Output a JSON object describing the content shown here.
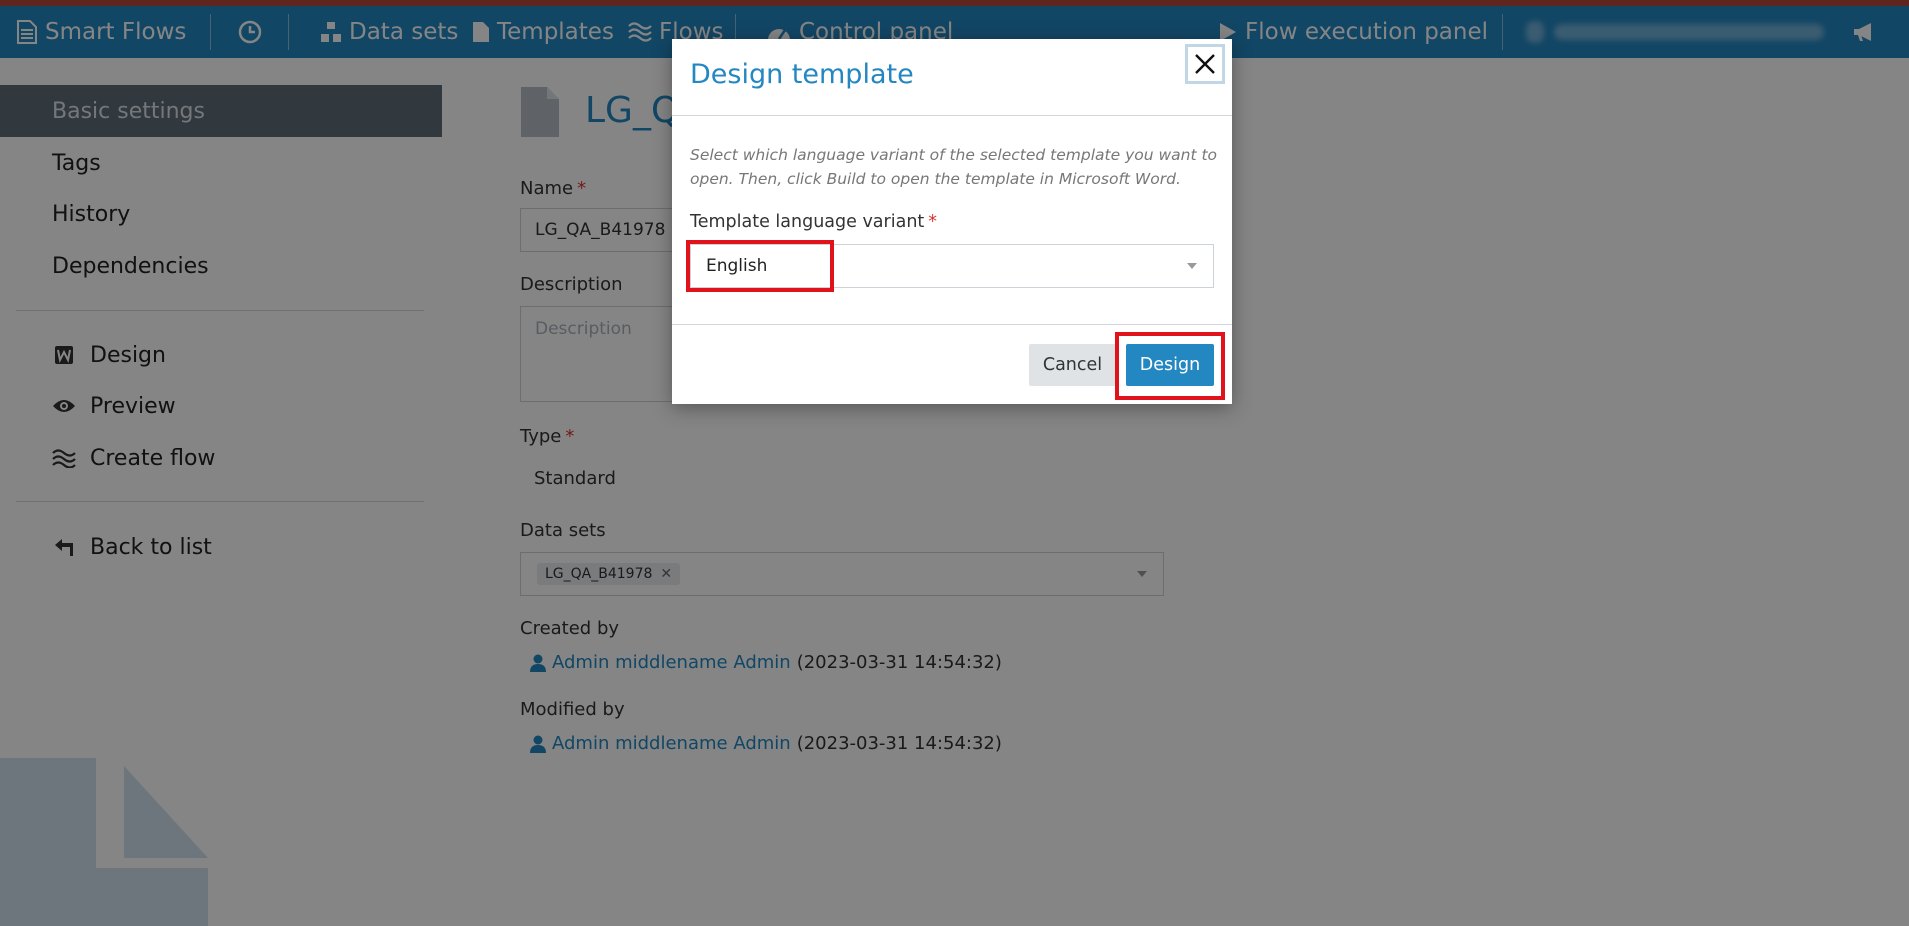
{
  "nav": {
    "brand": "Smart Flows",
    "items": [
      {
        "label": "Data sets"
      },
      {
        "label": "Templates"
      },
      {
        "label": "Flows"
      },
      {
        "label": "Control panel"
      }
    ],
    "execution_panel": "Flow execution panel"
  },
  "sidebar": {
    "items": [
      {
        "label": "Basic settings",
        "active": true
      },
      {
        "label": "Tags"
      },
      {
        "label": "History"
      },
      {
        "label": "Dependencies"
      }
    ],
    "actions": [
      {
        "label": "Design",
        "icon": "word-icon"
      },
      {
        "label": "Preview",
        "icon": "eye-icon"
      },
      {
        "label": "Create flow",
        "icon": "flows-icon"
      }
    ],
    "back_label": "Back to list"
  },
  "main": {
    "title": "LG_Q",
    "name_label": "Name",
    "name_value": "LG_QA_B41978",
    "description_label": "Description",
    "description_placeholder": "Description",
    "type_label": "Type",
    "type_value": "Standard",
    "datasets_label": "Data sets",
    "dataset_tag": "LG_QA_B41978",
    "created_label": "Created by",
    "created_user": "Admin middlename Admin",
    "created_date": "(2023-03-31 14:54:32)",
    "modified_label": "Modified by",
    "modified_user": "Admin middlename Admin",
    "modified_date": "(2023-03-31 14:54:32)"
  },
  "modal": {
    "title": "Design template",
    "description": "Select which language variant of the selected template you want to open. Then, click Build to open the template in Microsoft Word.",
    "field_label": "Template language variant",
    "selected_value": "English",
    "cancel_label": "Cancel",
    "design_label": "Design"
  },
  "colors": {
    "accent": "#2387c2",
    "highlight": "#e0131c",
    "sidebar_active": "#5f6b78"
  }
}
